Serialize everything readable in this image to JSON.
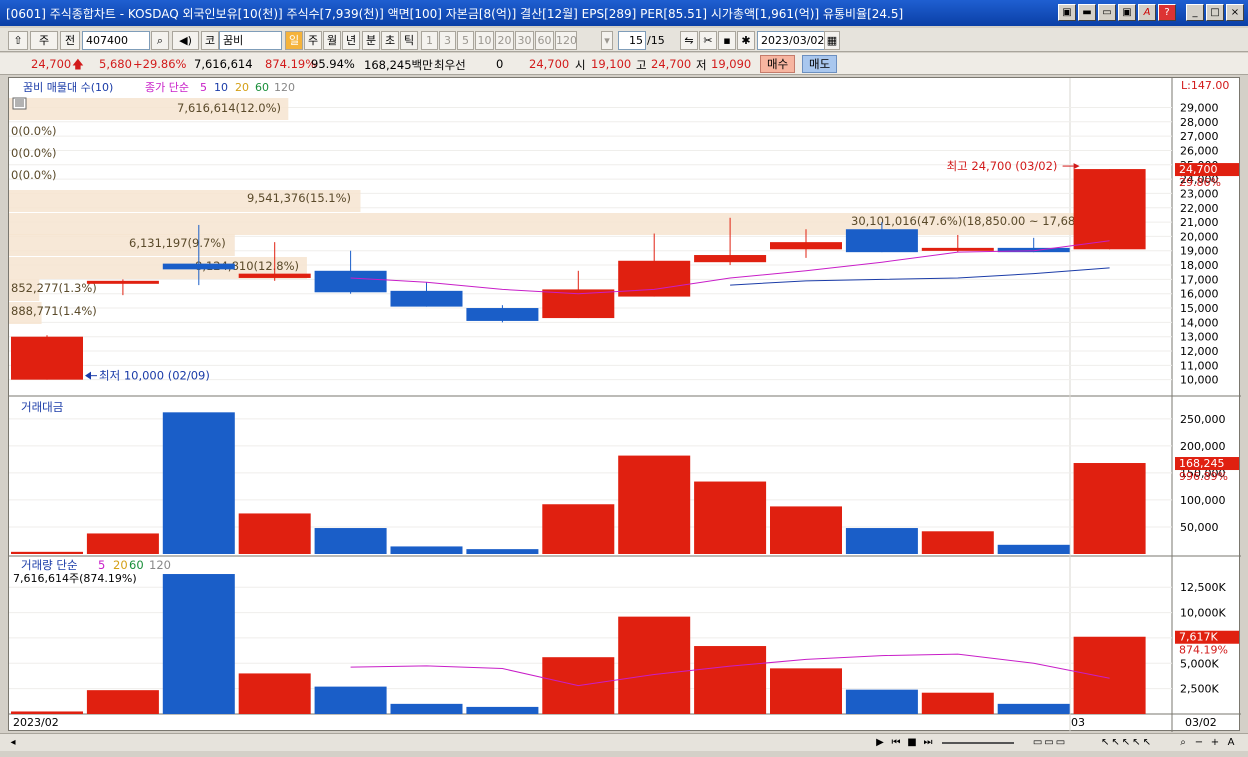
{
  "window": {
    "title": "[0601] 주식종합차트 - KOSDAQ 외국인보유[10(천)] 주식수[7,939(천)] 액면[100] 자본금[8(억)] 결산[12월] EPS[289] PER[85.51] 시가총액[1,961(억)] 유통비율[24.5]",
    "buttons": [
      "▣",
      "▬",
      "▭",
      "▣",
      "A",
      "?",
      "_",
      "□",
      "×"
    ]
  },
  "toolbar": {
    "market": "주",
    "market2": "전",
    "code": "407400",
    "stock_prefix": "코",
    "stock_name": "꿈비",
    "periods": [
      "일",
      "주",
      "월",
      "년",
      "분",
      "초",
      "틱"
    ],
    "active_period": "일",
    "intervals": [
      "1",
      "3",
      "5",
      "10",
      "20",
      "30",
      "60",
      "120"
    ],
    "count": "15",
    "count_total": "/15",
    "date": "2023/03/02"
  },
  "quote": {
    "price": "24,700",
    "change": "5,680",
    "change_pct": "+29.86%",
    "volume": "7,616,614",
    "volume_ratio": "874.19%",
    "ratio2": "95.94%",
    "amount": "168,245백만",
    "label_pref": "최우선",
    "pref_value": "0",
    "ask": "24,700",
    "open_label": "시",
    "open": "19,100",
    "high_label": "고",
    "high": "24,700",
    "low_label": "저",
    "low": "19,090",
    "buy": "매수",
    "sell": "매도"
  },
  "panels": {
    "price": {
      "title": "꿈비 매물대 수(10)",
      "ma_label": "종가 단순",
      "ma_periods": [
        "5",
        "10",
        "20",
        "60",
        "120"
      ],
      "ma_colors": [
        "#c81ec8",
        "#1b3ca8",
        "#d4a017",
        "#1a8f3a",
        "#888888"
      ],
      "right_top": "L:147.00",
      "last_price": "24,700",
      "last_pct": "29.86%",
      "high_note": "최고 24,700 (03/02)",
      "low_note": "최저 10,000 (02/09)",
      "ticks": [
        "29,000",
        "28,000",
        "27,000",
        "26,000",
        "25,000",
        "24,000",
        "23,000",
        "22,000",
        "21,000",
        "20,000",
        "19,000",
        "18,000",
        "17,000",
        "16,000",
        "15,000",
        "14,000",
        "13,000",
        "12,000",
        "11,000",
        "10,000"
      ]
    },
    "amount": {
      "title": "거래대금",
      "last": "168,245",
      "last_pct": "996.89%",
      "ticks": [
        "250,000",
        "200,000",
        "150,000",
        "100,000",
        "50,000"
      ]
    },
    "volume": {
      "title": "거래량 단순",
      "ma_periods": [
        "5",
        "20",
        "60",
        "120"
      ],
      "ma_colors": [
        "#c81ec8",
        "#d4a017",
        "#1a8f3a",
        "#888888"
      ],
      "subtitle": "7,616,614주(874.19%)",
      "last": "7,617K",
      "last_pct": "874.19%",
      "ticks": [
        "12,500K",
        "10,000K",
        "7,500K",
        "5,000K",
        "2,500K"
      ]
    }
  },
  "xaxis": {
    "start": "2023/02",
    "mid": "03",
    "end": "03/02"
  },
  "chart_data": {
    "type": "candlestick",
    "price_range": [
      9000,
      29800
    ],
    "candles": [
      {
        "o": 10000,
        "h": 13100,
        "l": 10000,
        "c": 13000,
        "color": "red"
      },
      {
        "o": 16800,
        "h": 17000,
        "l": 15900,
        "c": 16900,
        "color": "red"
      },
      {
        "o": 18100,
        "h": 20800,
        "l": 16600,
        "c": 17700,
        "color": "blue"
      },
      {
        "o": 17100,
        "h": 19600,
        "l": 16900,
        "c": 17400,
        "color": "red"
      },
      {
        "o": 17600,
        "h": 19000,
        "l": 16000,
        "c": 16100,
        "color": "blue"
      },
      {
        "o": 16200,
        "h": 16800,
        "l": 15100,
        "c": 15100,
        "color": "blue"
      },
      {
        "o": 15000,
        "h": 15200,
        "l": 14000,
        "c": 14100,
        "color": "blue"
      },
      {
        "o": 14300,
        "h": 17600,
        "l": 14300,
        "c": 16300,
        "color": "red"
      },
      {
        "o": 15800,
        "h": 20200,
        "l": 15800,
        "c": 18300,
        "color": "red"
      },
      {
        "o": 18200,
        "h": 21300,
        "l": 18000,
        "c": 18700,
        "color": "red"
      },
      {
        "o": 19100,
        "h": 20500,
        "l": 18500,
        "c": 19600,
        "color": "red"
      },
      {
        "o": 20500,
        "h": 21000,
        "l": 18900,
        "c": 18900,
        "color": "blue"
      },
      {
        "o": 19000,
        "h": 20100,
        "l": 18900,
        "c": 19200,
        "color": "red"
      },
      {
        "o": 19200,
        "h": 19900,
        "l": 18900,
        "c": 18900,
        "color": "blue"
      },
      {
        "o": 19100,
        "h": 24700,
        "l": 19090,
        "c": 24700,
        "color": "red"
      }
    ],
    "ma5": [
      null,
      null,
      null,
      null,
      17100,
      16800,
      16300,
      16000,
      16300,
      17100,
      17600,
      18200,
      18900,
      19000,
      19700
    ],
    "ma10": [
      null,
      null,
      null,
      null,
      null,
      null,
      null,
      null,
      null,
      16600,
      16900,
      17000,
      17100,
      17400,
      17800
    ],
    "volume_profile": [
      {
        "label": "7,616,614(12.0%)",
        "pct": 12.0
      },
      {
        "label": "0(0.0%)",
        "pct": 0
      },
      {
        "label": "0(0.0%)",
        "pct": 0
      },
      {
        "label": "0(0.0%)",
        "pct": 0
      },
      {
        "label": "9,541,376(15.1%)",
        "pct": 15.1
      },
      {
        "label": "30,101,016(47.6%)(18,850.00 ~ 17,680.00)",
        "pct": 47.6
      },
      {
        "label": "6,131,197(9.7%)",
        "pct": 9.7
      },
      {
        "label": "8,124,810(12.8%)",
        "pct": 12.8
      },
      {
        "label": "852,277(1.3%)",
        "pct": 1.3
      },
      {
        "label": "888,771(1.4%)",
        "pct": 1.4
      }
    ],
    "amount_range": [
      0,
      270000
    ],
    "amounts": [
      4000,
      38000,
      262000,
      75000,
      48000,
      14000,
      9000,
      92000,
      182000,
      134000,
      88000,
      48000,
      42000,
      17000,
      168245
    ],
    "volume_range": [
      0,
      14000
    ],
    "volumes": [
      250,
      2350,
      13800,
      4000,
      2700,
      1000,
      700,
      5600,
      9600,
      6700,
      4500,
      2400,
      2100,
      1000,
      7617
    ],
    "vol_ma5": [
      null,
      null,
      null,
      null,
      4620,
      4740,
      4480,
      2800,
      3900,
      4720,
      5380,
      5760,
      5900,
      5000,
      3520
    ]
  }
}
